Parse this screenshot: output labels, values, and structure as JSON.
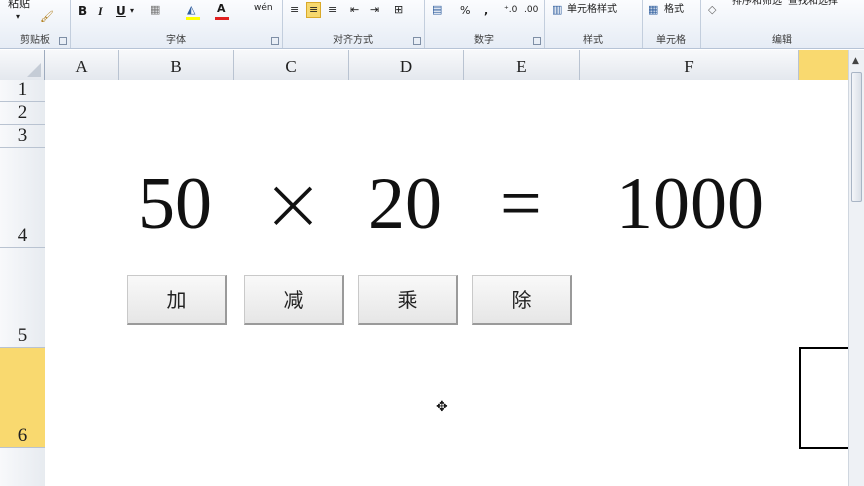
{
  "ribbon": {
    "clipboard": {
      "paste": "粘贴",
      "paste_arrow": "▾",
      "label": "剪贴板"
    },
    "font": {
      "label": "字体",
      "bold": "B",
      "italic": "I",
      "underline": "U",
      "phonetic": "wén"
    },
    "alignment": {
      "label": "对齐方式"
    },
    "number": {
      "label": "数字",
      "percent": "%",
      "comma": ","
    },
    "styles": {
      "label": "样式",
      "cell_styles": "单元格样式"
    },
    "cells": {
      "label": "单元格",
      "format": "格式"
    },
    "editing": {
      "label": "编辑",
      "sort_filter": "排序和筛选",
      "find_select": "查找和选择"
    }
  },
  "columns": [
    "A",
    "B",
    "C",
    "D",
    "E",
    "F"
  ],
  "rows": [
    "1",
    "2",
    "3",
    "4",
    "5",
    "6"
  ],
  "selected_row": "6",
  "equation": {
    "operand1": "50",
    "operator": "×",
    "operand2": "20",
    "equals": "=",
    "result": "1000"
  },
  "buttons": {
    "add": "加",
    "subtract": "减",
    "multiply": "乘",
    "divide": "除"
  },
  "icons": {
    "cursor": "move-cross-icon"
  }
}
